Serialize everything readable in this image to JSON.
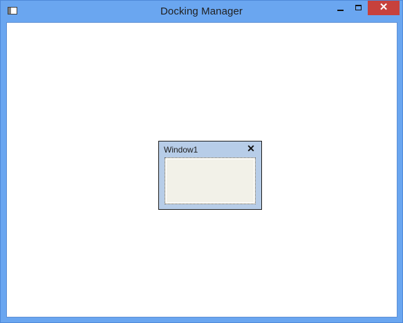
{
  "window": {
    "title": "Docking Manager",
    "controls": {
      "minimize": "",
      "maximize": "",
      "close": "✕"
    },
    "icons": {
      "app_icon": "app-window-icon",
      "minimize_icon": "minimize-icon",
      "maximize_icon": "maximize-icon",
      "close_icon": "close-icon"
    },
    "colors": {
      "frame": "#6aa6f0",
      "close_button": "#c7413c"
    }
  },
  "floating_window": {
    "title": "Window1",
    "close": "✕",
    "colors": {
      "header": "#b7cde8",
      "content": "#f2f1e8"
    }
  }
}
